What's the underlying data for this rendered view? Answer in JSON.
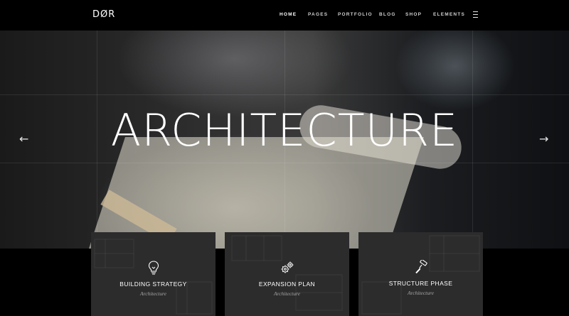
{
  "brand": {
    "logo_text": "DØR"
  },
  "nav": {
    "items": [
      {
        "label": "HOME",
        "active": true
      },
      {
        "label": "PAGES",
        "active": false
      },
      {
        "label": "PORTFOLIO",
        "active": false
      },
      {
        "label": "BLOG",
        "active": false
      },
      {
        "label": "SHOP",
        "active": false
      },
      {
        "label": "ELEMENTS",
        "active": false
      }
    ],
    "menu_icon": "hamburger-icon"
  },
  "hero": {
    "title": "ARCHITECTURE",
    "prev_arrow": "←",
    "next_arrow": "→"
  },
  "features": [
    {
      "icon": "lightbulb-icon",
      "title": "BUILDING STRATEGY",
      "subtitle": "Architecture"
    },
    {
      "icon": "gears-icon",
      "title": "EXPANSION PLAN",
      "subtitle": "Architecture"
    },
    {
      "icon": "paint-roller-icon",
      "title": "STRUCTURE PHASE",
      "subtitle": "Architecture"
    }
  ],
  "colors": {
    "header_bg": "#000000",
    "card_bg": "#2c2c2d",
    "text": "#ffffff",
    "subtitle": "#a8a8a8"
  }
}
